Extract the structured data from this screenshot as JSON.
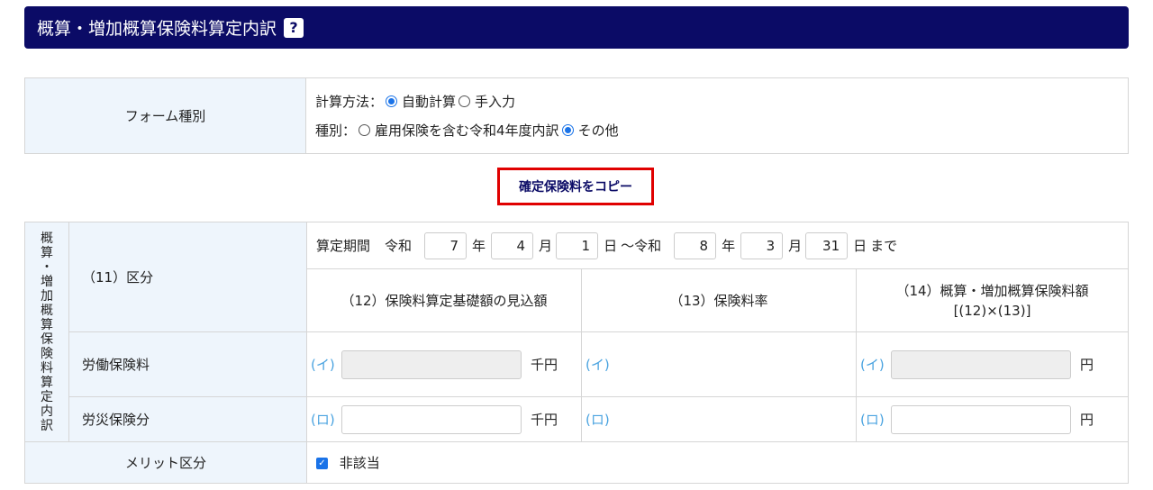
{
  "header": {
    "title": "概算・増加概算保険料算定内訳",
    "help": "?"
  },
  "form": {
    "label": "フォーム種別",
    "calc_label": "計算方法：",
    "calc_options": [
      "自動計算",
      "手入力"
    ],
    "type_label": "種別：",
    "type_options": [
      "雇用保険を含む令和4年度内訳",
      "その他"
    ]
  },
  "copy_button": "確定保険料をコピー",
  "breakdown": {
    "vertical_label": [
      "概",
      "算",
      "・",
      "増",
      "加",
      "概",
      "算",
      "保",
      "険",
      "料",
      "算",
      "定",
      "内",
      "訳"
    ],
    "division_label": "（11）区分",
    "period": {
      "label": "算定期間",
      "era1": "令和",
      "y1": "7",
      "nen1": "年",
      "m1": "4",
      "getsu1": "月",
      "d1": "1",
      "nichi1": "日",
      "sep": "～令和",
      "y2": "8",
      "nen2": "年",
      "m2": "3",
      "getsu2": "月",
      "d2": "31",
      "nichi2": "日",
      "until": "まで"
    },
    "col12": "（12）保険料算定基礎額の見込額",
    "col13": "（13）保険料率",
    "col14_line1": "（14）概算・増加概算保険料額",
    "col14_line2": "[(12)×(13)]",
    "rows": [
      {
        "label": "労働保険料",
        "mark": "(イ)",
        "unit12": "千円",
        "unit14": "円"
      },
      {
        "label": "労災保険分",
        "mark": "(ロ)",
        "unit12": "千円",
        "unit14": "円"
      }
    ]
  },
  "merit": {
    "label": "メリット区分",
    "checkbox_label": "非該当"
  },
  "colors": {
    "header_bg": "#0b0b66",
    "label_bg": "#eef5fc",
    "accent": "#1a73e8",
    "highlight": "#e00000"
  }
}
